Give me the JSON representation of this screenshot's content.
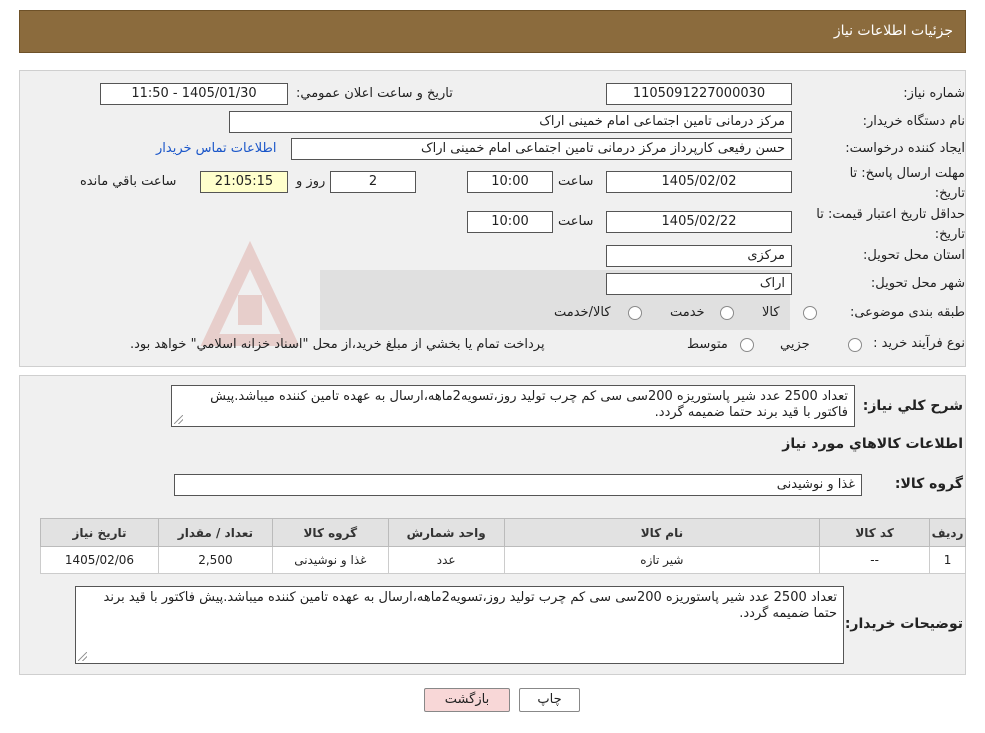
{
  "header": {
    "title": "جزئیات اطلاعات نیاز"
  },
  "form": {
    "need_number_label": "شماره نیاز:",
    "need_number": "1105091227000030",
    "announce_label": "تاریخ و ساعت اعلان عمومي:",
    "announce_value": "1405/01/30 - 11:50",
    "buyer_org_label": "نام دستگاه خريدار:",
    "buyer_org": "مرکز درمانی تامین اجتماعی امام خمینی اراک",
    "creator_label": "ايجاد كننده درخواست:",
    "creator": "حسن رفیعی کارپرداز مرکز درمانی تامین اجتماعی امام خمینی اراک",
    "contact_link": "اطلاعات تماس خريدار",
    "deadline_label": "مهلت ارسال پاسخ: تا تاريخ:",
    "deadline_date": "1405/02/02",
    "time_label": "ساعت",
    "deadline_time": "10:00",
    "days_value": "2",
    "days_label": "روز و",
    "remaining_time": "21:05:15",
    "remaining_label": "ساعت باقي مانده",
    "validity_label": "حداقل تاريخ اعتبار قيمت: تا تاريخ:",
    "validity_date": "1405/02/22",
    "validity_time": "10:00",
    "province_label": "استان محل تحويل:",
    "province": "مرکزی",
    "city_label": "شهر محل تحويل:",
    "city": "اراک",
    "category_label": "طبقه بندی موضوعی:",
    "category_options": [
      "کالا",
      "خدمت",
      "کالا/خدمت"
    ],
    "process_label": "نوع فرآيند خريد :",
    "process_options": [
      "جزيي",
      "متوسط"
    ],
    "process_note": "پرداخت تمام يا بخشي از مبلغ خريد،از محل \"اسناد خزانه اسلامي\" خواهد بود."
  },
  "details": {
    "summary_label": "شرح كلي نياز:",
    "summary": "تعداد 2500 عدد شیر پاستوریزه 200سی سی کم چرب تولید روز،تسویه2ماهه،ارسال به عهده تامین کننده میباشد.پیش فاکتور با قید برند حتما ضمیمه گردد.",
    "goods_info_title": "اطلاعات كالاهاي مورد نياز",
    "goods_group_label": "گروه كالا:",
    "goods_group": "غذا و نوشیدنی",
    "table": {
      "headers": [
        "رديف",
        "كد كالا",
        "نام كالا",
        "واحد شمارش",
        "گروه كالا",
        "تعداد / مقدار",
        "تاريخ نياز"
      ],
      "rows": [
        [
          "1",
          "--",
          "شیر تازه",
          "عدد",
          "غذا و نوشیدنی",
          "2,500",
          "1405/02/06"
        ]
      ]
    },
    "buyer_notes_label": "توضيحات خريدار:",
    "buyer_notes": "تعداد 2500 عدد شیر پاستوریزه 200سی سی کم چرب تولید روز،تسویه2ماهه،ارسال به عهده تامین کننده میباشد.پیش فاکتور با قید برند حتما ضمیمه گردد."
  },
  "buttons": {
    "print": "چاپ",
    "back": "بازگشت"
  },
  "colors": {
    "header_bg": "#8b6b3d",
    "back_button_bg": "#f8d7d7",
    "timer_bg": "#ffffcc",
    "link": "#1a56c9"
  }
}
